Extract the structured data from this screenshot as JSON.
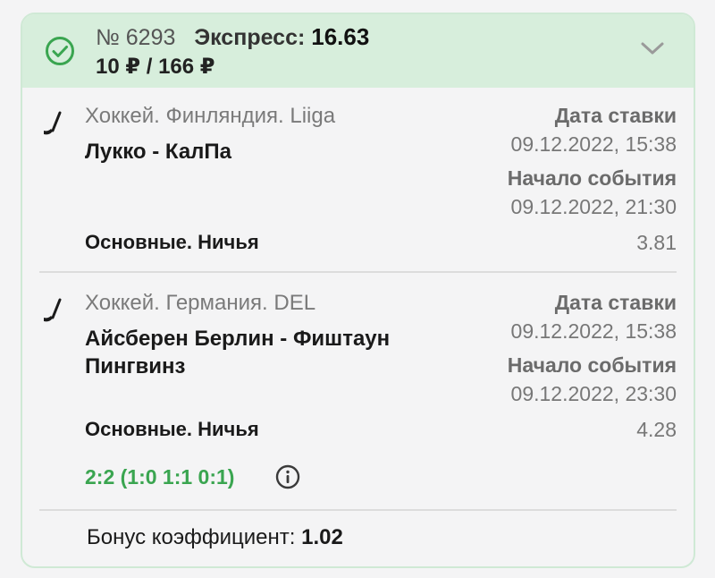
{
  "bet": {
    "number": "№ 6293",
    "type_label": "Экспресс:",
    "coefficient": "16.63",
    "amounts": "10 ₽ / 166 ₽",
    "status_icon": "check-circle-icon",
    "expand_icon": "chevron-down-icon",
    "accent_color": "#3aa550"
  },
  "events": [
    {
      "sport_icon": "hockey-stick-icon",
      "league": "Хоккей. Финляндия. Liiga",
      "teams": "Лукко - КалПа",
      "bet_date_label": "Дата ставки",
      "bet_date": "09.12.2022, 15:38",
      "start_label": "Начало события",
      "start_date": "09.12.2022, 21:30",
      "market": "Основные. Ничья",
      "odds": "3.81"
    },
    {
      "sport_icon": "hockey-stick-icon",
      "league": "Хоккей. Германия. DEL",
      "teams": "Айсберен Берлин - Фиштаун Пингвинз",
      "bet_date_label": "Дата ставки",
      "bet_date": "09.12.2022, 15:38",
      "start_label": "Начало события",
      "start_date": "09.12.2022, 23:30",
      "market": "Основные. Ничья",
      "odds": "4.28",
      "score": "2:2 (1:0 1:1 0:1)",
      "info_icon": "info-icon"
    }
  ],
  "bonus": {
    "label": "Бонус коэффициент:",
    "value": "1.02"
  }
}
